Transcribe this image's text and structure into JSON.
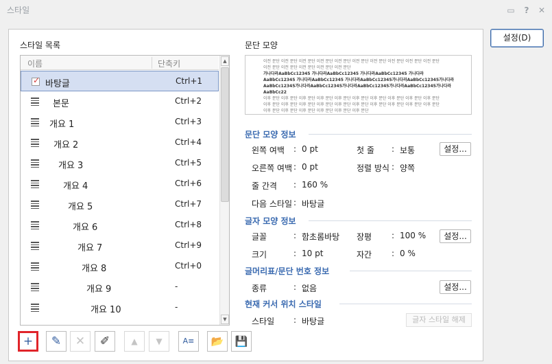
{
  "window": {
    "title": "스타일",
    "icons": [
      "chat-icon",
      "help-icon",
      "close-icon"
    ],
    "help_glyph": "?",
    "close_glyph": "✕",
    "chat_glyph": "▭"
  },
  "primary_button": "설정(D)",
  "style_list": {
    "label": "스타일 목록",
    "col_name": "이름",
    "col_key": "단축키",
    "items": [
      {
        "name": "바탕글",
        "key": "Ctrl+1",
        "selected": true
      },
      {
        "name": "본문",
        "key": "Ctrl+2"
      },
      {
        "name": "개요 1",
        "key": "Ctrl+3"
      },
      {
        "name": "개요 2",
        "key": "Ctrl+4"
      },
      {
        "name": "개요 3",
        "key": "Ctrl+5"
      },
      {
        "name": "개요 4",
        "key": "Ctrl+6"
      },
      {
        "name": "개요 5",
        "key": "Ctrl+7"
      },
      {
        "name": "개요 6",
        "key": "Ctrl+8"
      },
      {
        "name": "개요 7",
        "key": "Ctrl+9"
      },
      {
        "name": "개요 8",
        "key": "Ctrl+0"
      },
      {
        "name": "개요 9",
        "key": "-"
      },
      {
        "name": "개요 10",
        "key": "-"
      }
    ]
  },
  "toolbar": {
    "add": "+",
    "edit": "✎",
    "delete": "✕",
    "replace": "✐",
    "move_up": "▲",
    "move_down": "▼",
    "import": "A≡",
    "open": "📂",
    "save": "💾"
  },
  "preview": {
    "label": "문단 모양",
    "lines": [
      "이전 문단 이전 문단 이전 문단 이전 문단 이전 문단 이전 문단 이전 문단 이전 문단 이전 문단 이전 문단",
      "이전 문단 이전 문단 이전 문단 이전 문단 이전 문단",
      "가나다라AaBbCc12345 가나다라AaBbCc12345 가나다라AaBbCc12345 가나다라",
      "AaBbCc12345 가나다라AaBbCc12345 가나다라AaBbCc12345가나다라AaBbCc12345가나다라",
      "AaBbCc12345가나다라AaBbCc12345가나다라AaBbCc12345가나다라AaBbCc12345가나다라",
      "AaBbCc22",
      "이후 문단 이후 문단 이후 문단 이후 문단 이후 문단 이후 문단 이후 문단 이후 문단 이후 문단 이후 문단",
      "이후 문단 이후 문단 이후 문단 이후 문단 이후 문단 이후 문단 이후 문단 이후 문단 이후 문단 이후 문단",
      "이후 문단 이후 문단 이후 문단 이후 문단 이후 문단 이후 문단"
    ]
  },
  "paragraph_info": {
    "title": "문단 모양 정보",
    "left_margin_label": "왼쪽 여백",
    "left_margin": "0 pt",
    "right_margin_label": "오른쪽 여백",
    "right_margin": "0 pt",
    "first_line_label": "첫 줄",
    "first_line": "보통",
    "align_label": "정렬 방식",
    "align": "양쪽",
    "line_spacing_label": "줄 간격",
    "line_spacing": "160 %",
    "next_style_label": "다음 스타일",
    "next_style": "바탕글",
    "settings": "설정..."
  },
  "char_info": {
    "title": "글자 모양 정보",
    "font_label": "글꼴",
    "font": "함초롬바탕",
    "width_label": "장평",
    "width": "100 %",
    "size_label": "크기",
    "size": "10 pt",
    "spacing_label": "자간",
    "spacing": "0 %",
    "settings": "설정..."
  },
  "bullet_info": {
    "title": "글머리표/문단 번호 정보",
    "type_label": "종류",
    "type": "없음",
    "settings": "설정..."
  },
  "cursor_info": {
    "title": "현재 커서 위치 스타일",
    "style_label": "스타일",
    "style": "바탕글",
    "release": "글자 스타일 해제"
  },
  "colon": ":"
}
